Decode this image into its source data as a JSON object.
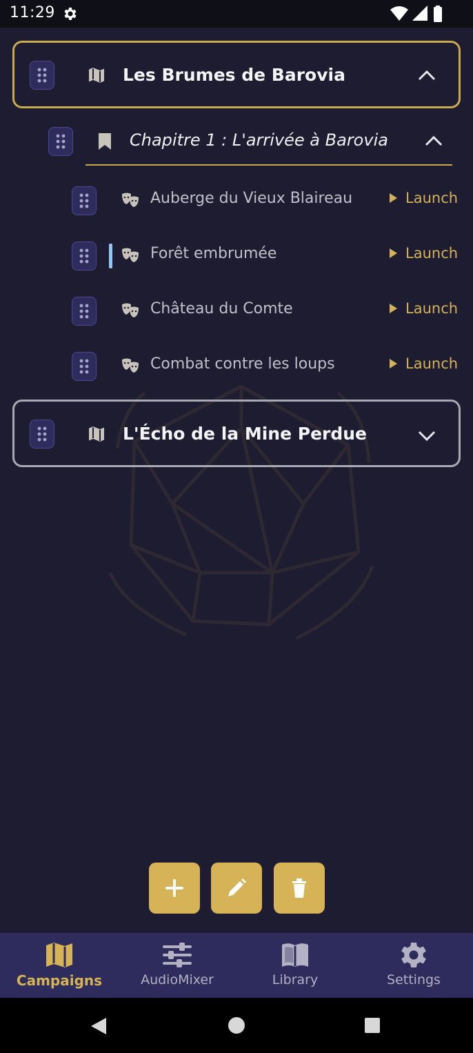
{
  "status_bar": {
    "time": "11:29"
  },
  "campaigns": [
    {
      "title": "Les Brumes de Barovia",
      "expanded": true,
      "chapters": [
        {
          "title": "Chapitre 1 : L'arrivée à Barovia",
          "scenes": [
            {
              "name": "Auberge du Vieux Blaireau",
              "launch_label": "Launch"
            },
            {
              "name": "Forêt embrumée",
              "launch_label": "Launch",
              "active": true
            },
            {
              "name": "Château du Comte",
              "launch_label": "Launch"
            },
            {
              "name": "Combat contre les loups",
              "launch_label": "Launch"
            }
          ]
        }
      ]
    },
    {
      "title": "L'Écho de la Mine Perdue",
      "expanded": false
    }
  ],
  "bottom_nav": {
    "items": [
      {
        "label": "Campaigns",
        "icon": "map-icon",
        "active": true
      },
      {
        "label": "AudioMixer",
        "icon": "sliders-icon"
      },
      {
        "label": "Library",
        "icon": "book-icon"
      },
      {
        "label": "Settings",
        "icon": "gear-icon"
      }
    ]
  },
  "colors": {
    "background": "#1d1c31",
    "accent_gold": "#d6b356",
    "nav_background": "#2e2c5c",
    "active_marker": "#8fc8f5"
  }
}
